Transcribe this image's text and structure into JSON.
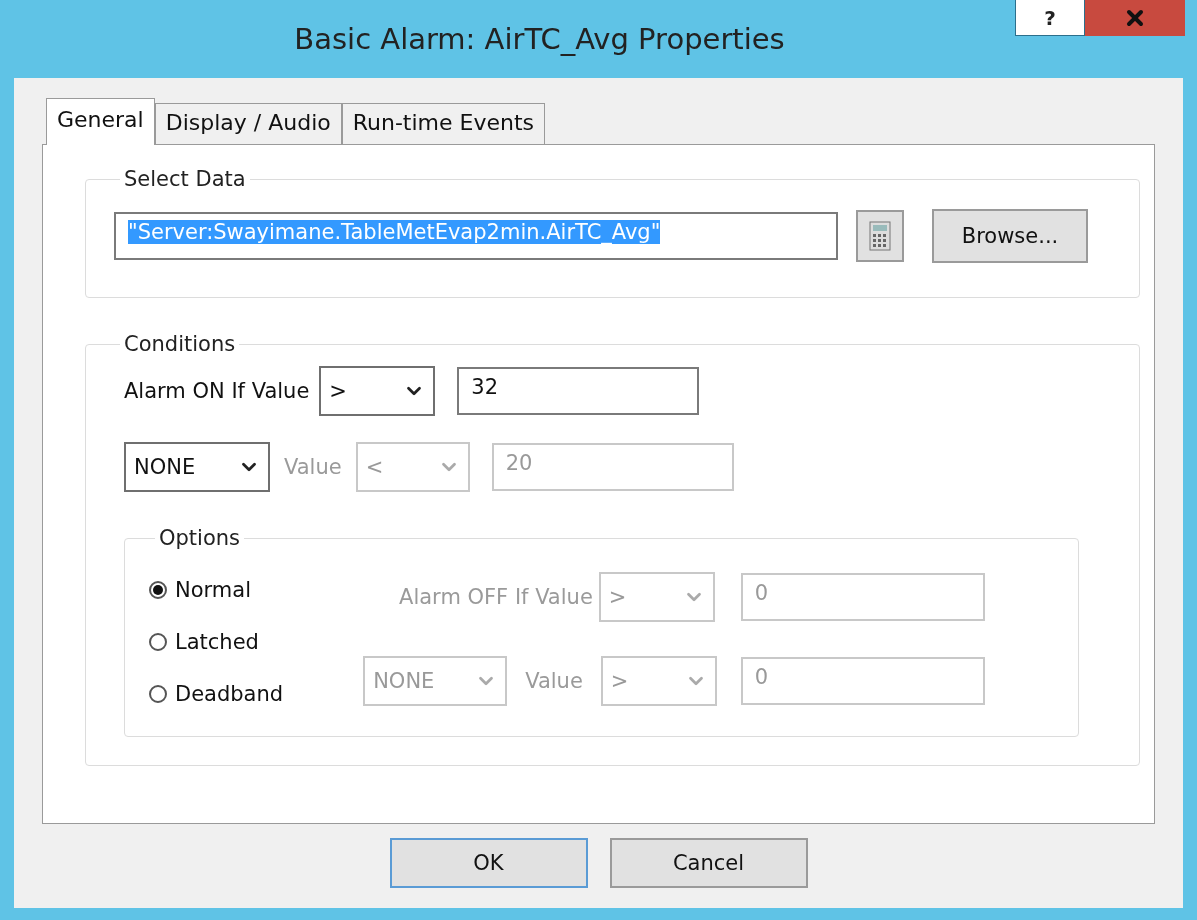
{
  "window": {
    "title": "Basic Alarm: AirTC_Avg Properties",
    "help_button": "?"
  },
  "tabs": [
    {
      "label": "General",
      "selected": true
    },
    {
      "label": "Display / Audio",
      "selected": false
    },
    {
      "label": "Run-time Events",
      "selected": false
    }
  ],
  "select_data": {
    "label": "Select Data",
    "value": "\"Server:Swayimane.TableMetEvap2min.AirTC_Avg\"",
    "value_selected": true,
    "browse_button": "Browse..."
  },
  "conditions": {
    "label": "Conditions",
    "alarm_on": {
      "label": "Alarm ON If Value",
      "operator": ">",
      "value": "32",
      "disabled": false
    },
    "second": {
      "combine": "NONE",
      "label": "Value",
      "operator": "<",
      "value": "20",
      "disabled": true
    },
    "options": {
      "label": "Options",
      "modes": [
        {
          "label": "Normal",
          "selected": true
        },
        {
          "label": "Latched",
          "selected": false
        },
        {
          "label": "Deadband",
          "selected": false
        }
      ],
      "alarm_off": {
        "label": "Alarm OFF If Value",
        "operator": ">",
        "value": "0",
        "disabled": true
      },
      "second": {
        "combine": "NONE",
        "label": "Value",
        "operator": ">",
        "value": "0",
        "disabled": true
      }
    }
  },
  "buttons": [
    {
      "label": "OK",
      "default": true
    },
    {
      "label": "Cancel",
      "default": false
    }
  ]
}
